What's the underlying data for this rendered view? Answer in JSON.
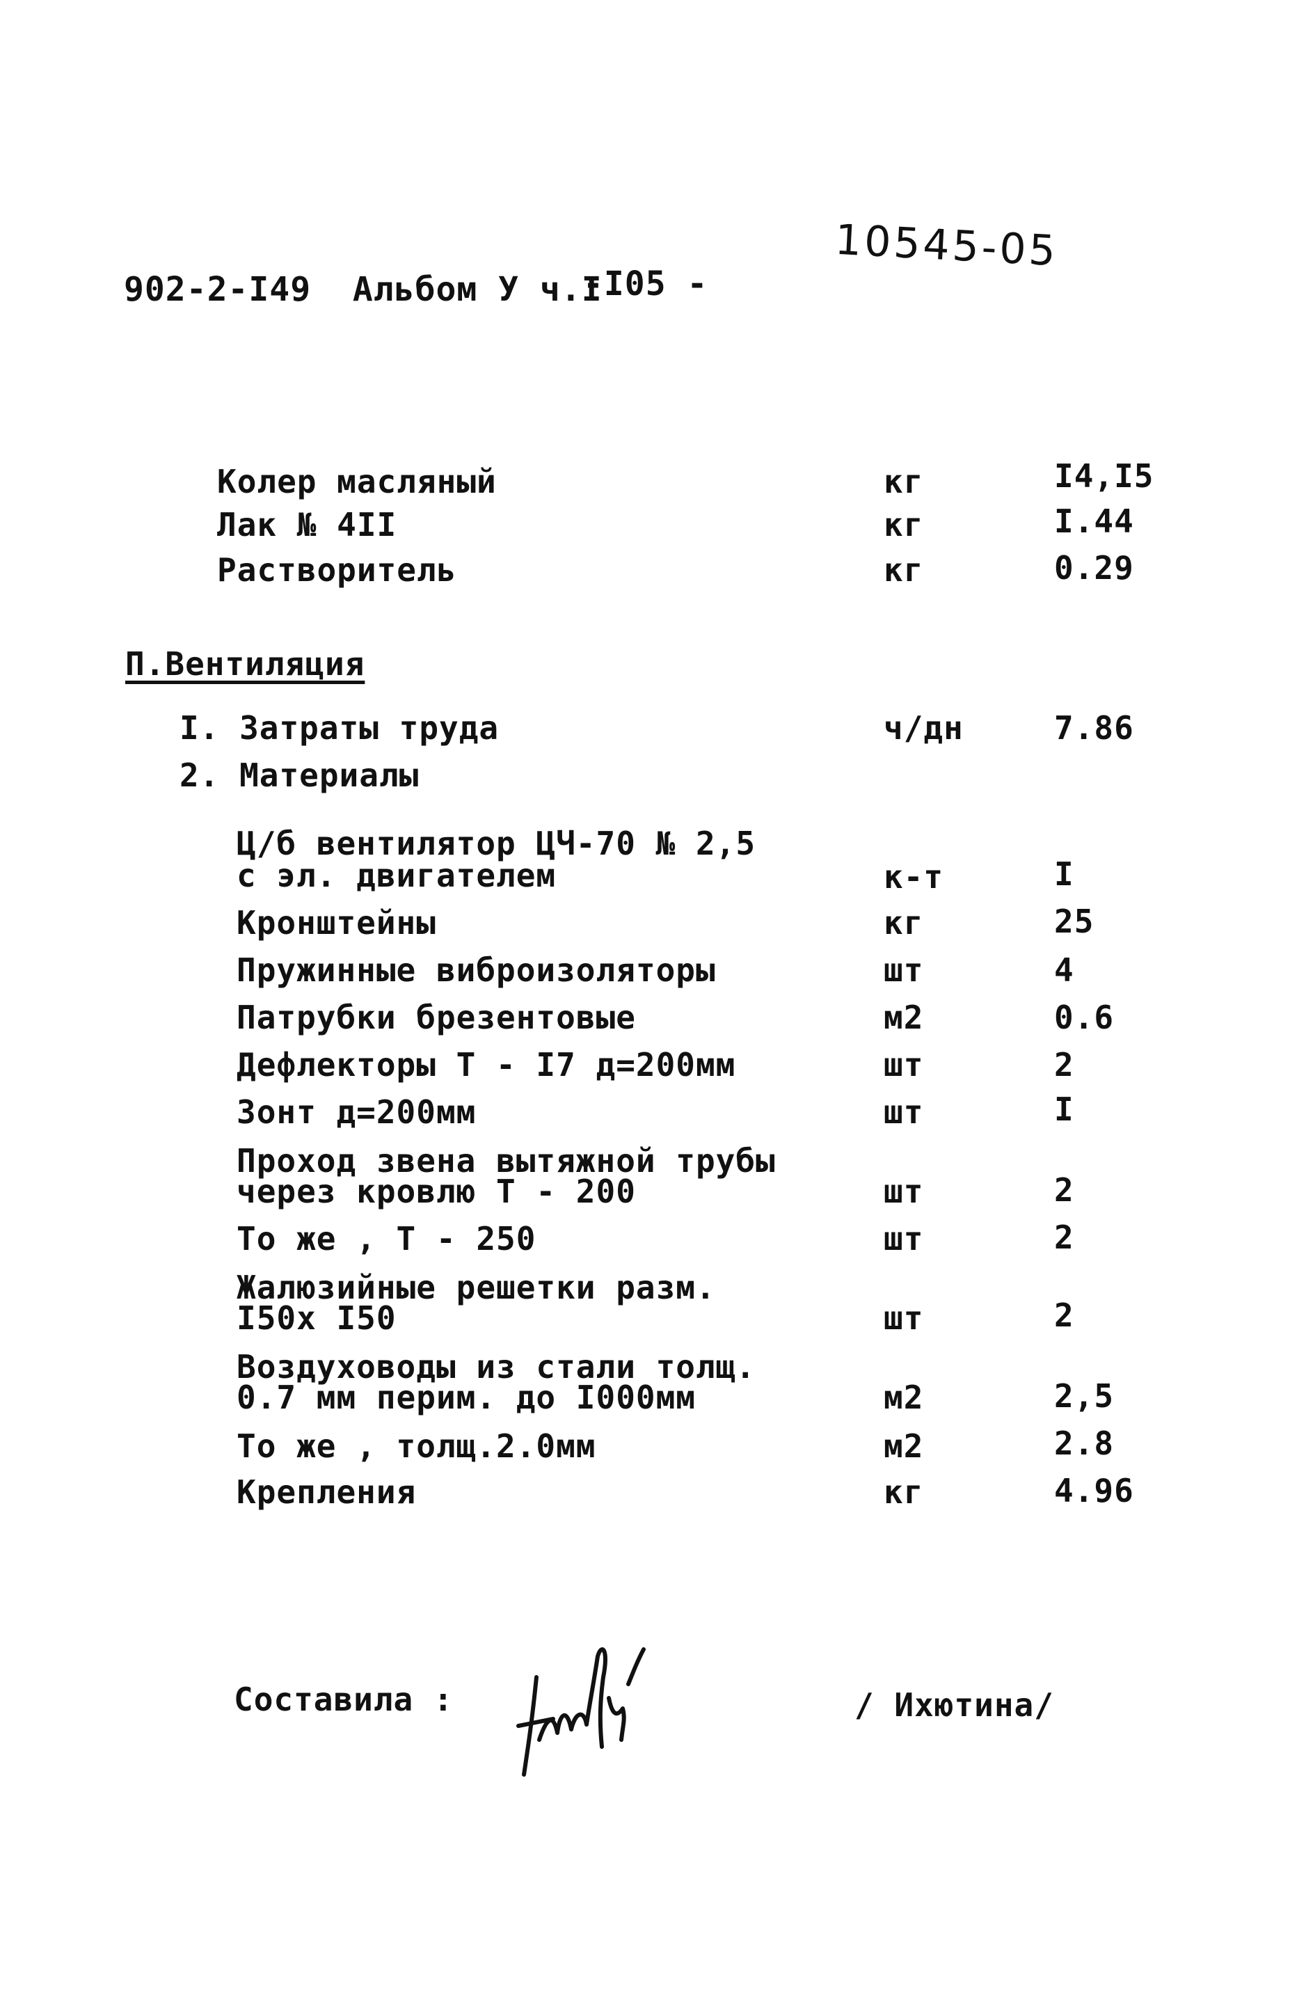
{
  "header": {
    "doc_code": "902-2-I49  Альбом У ч.I",
    "page_number": "-I05 -",
    "handwritten_number": "10545-05"
  },
  "paint_items": [
    {
      "name": "Колер масляный",
      "unit": "кг",
      "qty": "I4,I5"
    },
    {
      "name": "Лак № 4II",
      "unit": "кг",
      "qty": "I.44"
    },
    {
      "name": "Растворитель",
      "unit": "кг",
      "qty": "0.29"
    }
  ],
  "section": {
    "title": "П.Вентиляция",
    "labor": {
      "label": "I. Затраты труда",
      "unit": "ч/дн",
      "qty": "7.86"
    },
    "materials_label": "2. Материалы",
    "materials": [
      {
        "name_line1": "Ц/б вентилятор ЦЧ-70 № 2,5",
        "name_line2": "с эл. двигателем",
        "unit": "к-т",
        "qty": "I"
      },
      {
        "name_line1": "Кронштейны",
        "unit": "кг",
        "qty": "25"
      },
      {
        "name_line1": "Пружинные виброизоляторы",
        "unit": "шт",
        "qty": "4"
      },
      {
        "name_line1": "Патрубки брезентовые",
        "unit": "м2",
        "qty": "0.6"
      },
      {
        "name_line1": "Дефлекторы Т - I7 д=200мм",
        "unit": "шт",
        "qty": "2"
      },
      {
        "name_line1": "Зонт д=200мм",
        "unit": "шт",
        "qty": "I"
      },
      {
        "name_line1": "Проход звена вытяжной трубы",
        "name_line2": "через кровлю Т - 200",
        "unit": "шт",
        "qty": "2"
      },
      {
        "name_line1": "То же , Т - 250",
        "unit": "шт",
        "qty": "2"
      },
      {
        "name_line1": "Жалюзийные решетки разм.",
        "name_line2": "I50х I50",
        "unit": "шт",
        "qty": "2"
      },
      {
        "name_line1": "Воздуховоды из стали толщ.",
        "name_line2": "0.7 мм перим. до I000мм",
        "unit": "м2",
        "qty": "2,5"
      },
      {
        "name_line1": "То же , толщ.2.0мм",
        "unit": "м2",
        "qty": "2.8"
      },
      {
        "name_line1": "Крепления",
        "unit": "кг",
        "qty": "4.96"
      }
    ]
  },
  "footer": {
    "compiled_by_label": "Составила :",
    "compiler_name": "/ Ихютина/"
  }
}
